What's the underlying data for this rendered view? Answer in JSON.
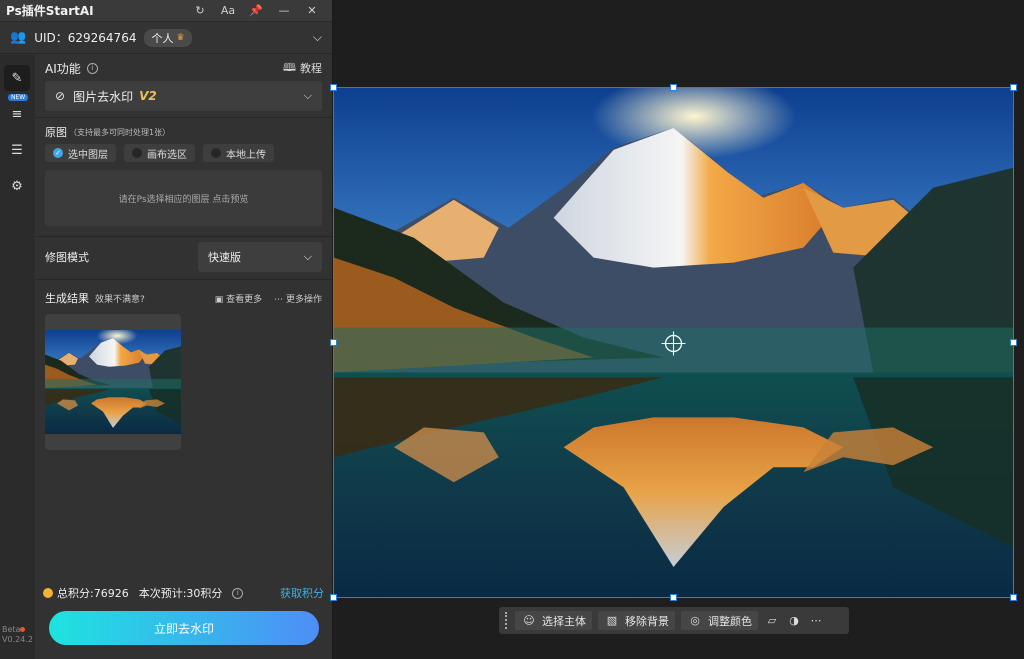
{
  "panel": {
    "title": "Ps插件StartAI",
    "uid_text": "UID：629264764",
    "plan_badge": "个人",
    "sidebar_new_tag": "NEW",
    "ai_function_label": "AI功能",
    "tutorial_label": "教程",
    "function_select": {
      "value": "图片去水印",
      "version": "V2"
    },
    "source": {
      "label": "原图",
      "note": "（支持最多可同时处理1张）",
      "options": [
        "选中图层",
        "画布选区",
        "本地上传"
      ],
      "selected_index": 0,
      "preview_hint": "请在Ps选择相应的图层 点击预览"
    },
    "mode": {
      "label": "修图模式",
      "value": "快速版"
    },
    "results": {
      "label": "生成结果",
      "unsatisfied": "效果不满意?",
      "view_more": "查看更多",
      "more_actions": "更多操作"
    },
    "points": {
      "total": "总积分:76926",
      "estimate": "本次预计:30积分",
      "get_points": "获取积分"
    },
    "action_button": "立即去水印",
    "beta_label": "Beta",
    "version_label": "V0.24.2"
  },
  "toolbar": {
    "select_subject": "选择主体",
    "remove_background": "移除背景",
    "adjust_color": "调整颜色"
  },
  "icons": {
    "refresh": "refresh-icon",
    "font": "font-size-icon",
    "pin": "pin-icon",
    "minimize": "minimize-icon",
    "close": "close-icon"
  }
}
